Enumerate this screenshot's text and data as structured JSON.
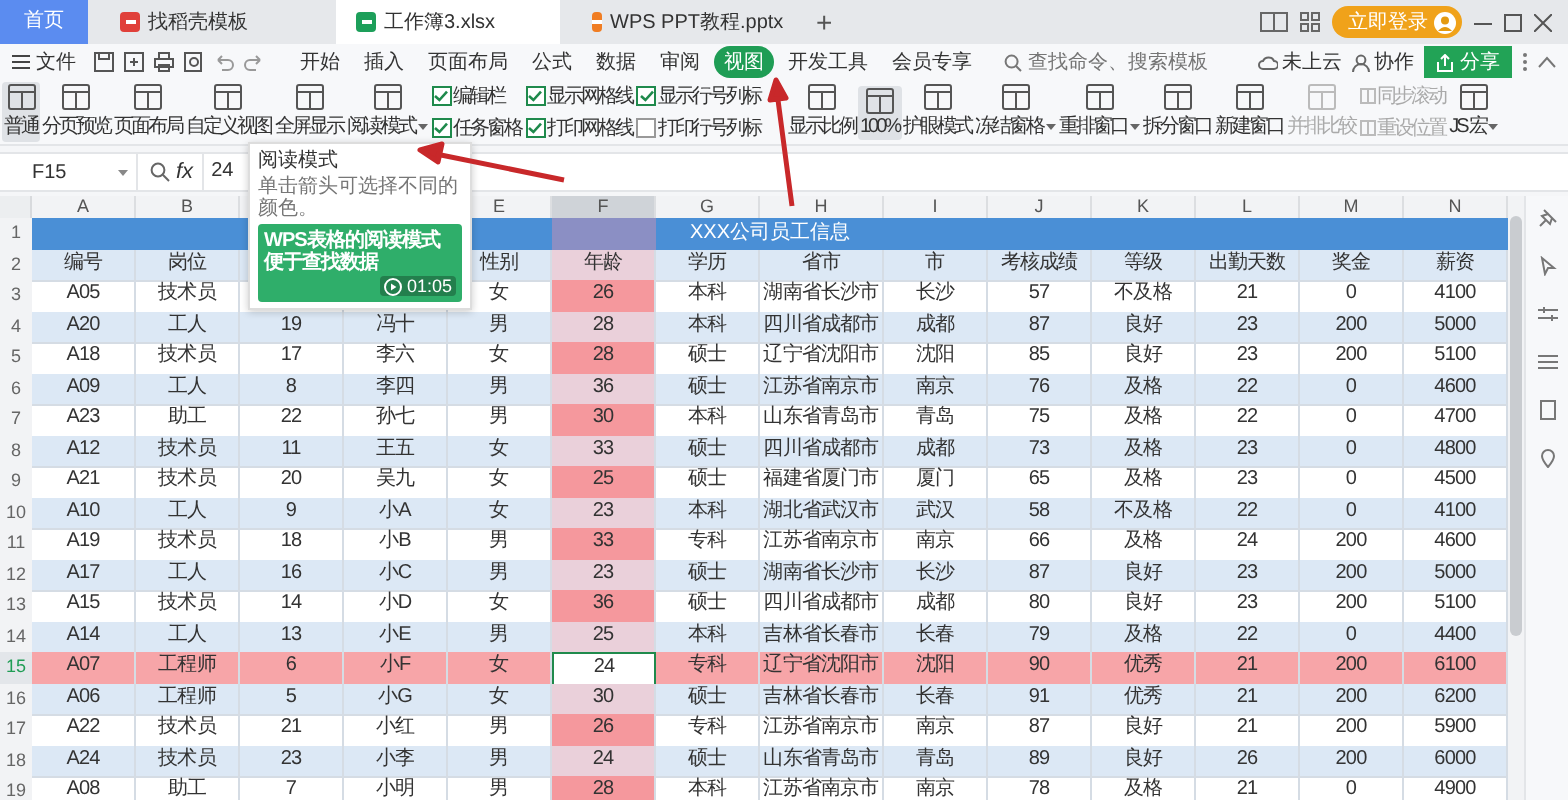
{
  "window_tabs": [
    {
      "label": "首页",
      "kind": "home",
      "selected": false
    },
    {
      "label": "找稻壳模板",
      "kind": "docer",
      "selected": false
    },
    {
      "label": "工作簿3.xlsx",
      "kind": "sheet",
      "selected": true
    },
    {
      "label": "WPS PPT教程.pptx",
      "kind": "ppt",
      "selected": false
    }
  ],
  "new_tab": "+",
  "login_button": "立即登录",
  "menu": {
    "file": "文件",
    "tabs": [
      {
        "label": "开始",
        "selected": false
      },
      {
        "label": "插入",
        "selected": false
      },
      {
        "label": "页面布局",
        "selected": false
      },
      {
        "label": "公式",
        "selected": false
      },
      {
        "label": "数据",
        "selected": false
      },
      {
        "label": "审阅",
        "selected": false
      },
      {
        "label": "视图",
        "selected": true
      },
      {
        "label": "开发工具",
        "selected": false
      },
      {
        "label": "会员专享",
        "selected": false
      }
    ],
    "search": {
      "placeholder": "查找命令、搜索模板"
    },
    "cloud": "未上云",
    "collab": "协作",
    "share": "分享"
  },
  "ribbon": [
    {
      "kind": "button",
      "label": "普通",
      "selected": true,
      "disabled": false,
      "dropdown": false
    },
    {
      "kind": "button",
      "label": "分页预览",
      "selected": false,
      "disabled": false,
      "dropdown": false
    },
    {
      "kind": "button",
      "label": "页面布局",
      "selected": false,
      "disabled": false,
      "dropdown": false
    },
    {
      "kind": "button",
      "label": "自定义视图",
      "selected": false,
      "disabled": false,
      "dropdown": false
    },
    {
      "kind": "button",
      "label": "全屏显示",
      "selected": false,
      "disabled": false,
      "dropdown": false
    },
    {
      "kind": "button",
      "label": "阅读模式",
      "selected": false,
      "disabled": false,
      "dropdown": true
    },
    {
      "kind": "checks",
      "checks": [
        {
          "label": "编辑栏",
          "checked": true
        },
        {
          "label": "任务窗格",
          "checked": true
        }
      ]
    },
    {
      "kind": "checks",
      "checks": [
        {
          "label": "显示网格线",
          "checked": true
        },
        {
          "label": "打印网格线",
          "checked": true
        }
      ]
    },
    {
      "kind": "checks",
      "checks": [
        {
          "label": "显示行号列标",
          "checked": true
        },
        {
          "label": "打印行号列标",
          "checked": false
        }
      ]
    },
    {
      "kind": "button",
      "label": "显示比例",
      "selected": false,
      "disabled": false,
      "dropdown": false
    },
    {
      "kind": "button",
      "label": "100%",
      "selected": true,
      "disabled": false,
      "dropdown": false
    },
    {
      "kind": "button",
      "label": "护眼模式",
      "selected": false,
      "disabled": false,
      "dropdown": false
    },
    {
      "kind": "button",
      "label": "冻结窗格",
      "selected": false,
      "disabled": false,
      "dropdown": true
    },
    {
      "kind": "button",
      "label": "重排窗口",
      "selected": false,
      "disabled": false,
      "dropdown": true
    },
    {
      "kind": "button",
      "label": "拆分窗口",
      "selected": false,
      "disabled": false,
      "dropdown": false
    },
    {
      "kind": "button",
      "label": "新建窗口",
      "selected": false,
      "disabled": false,
      "dropdown": false
    },
    {
      "kind": "button",
      "label": "并排比较",
      "selected": false,
      "disabled": true,
      "dropdown": false
    },
    {
      "kind": "smalls",
      "items": [
        {
          "label": "同步滚动",
          "disabled": true
        },
        {
          "label": "重设位置",
          "disabled": true
        }
      ]
    },
    {
      "kind": "button",
      "label": "JS 宏",
      "selected": false,
      "disabled": false,
      "dropdown": true
    }
  ],
  "formula_bar": {
    "cell": "F15",
    "fx": "fx",
    "value": "24"
  },
  "tooltip": {
    "title": "阅读模式",
    "text": "单击箭头可选择不同的颜色。",
    "video_title": "WPS表格的阅读模式便于查找数据",
    "duration": "01:05"
  },
  "sheet": {
    "columns": [
      {
        "label": "A",
        "selected": false
      },
      {
        "label": "B",
        "selected": false
      },
      null,
      null,
      {
        "label": "E",
        "selected": false
      },
      {
        "label": "F",
        "selected": true
      },
      {
        "label": "G",
        "selected": false
      },
      {
        "label": "H",
        "selected": false
      },
      {
        "label": "I",
        "selected": false
      },
      {
        "label": "J",
        "selected": false
      },
      {
        "label": "K",
        "selected": false
      },
      {
        "label": "L",
        "selected": false
      },
      {
        "label": "M",
        "selected": false
      },
      {
        "label": "N",
        "selected": false
      }
    ],
    "title_row": {
      "number": "1",
      "title": "XXX公司员工信息"
    },
    "rows": [
      {
        "number": "2",
        "selected": false,
        "cells": [
          "编号",
          "岗位",
          null,
          null,
          "性别",
          "年龄",
          "学历",
          "省市",
          "市",
          "考核成绩",
          "等级",
          "出勤天数",
          "奖金",
          "薪资"
        ]
      },
      {
        "number": "3",
        "selected": false,
        "cells": [
          "A05",
          "技术员",
          null,
          null,
          "女",
          "26",
          "本科",
          "湖南省长沙市",
          "长沙",
          "57",
          "不及格",
          "21",
          "0",
          "4100"
        ]
      },
      {
        "number": "4",
        "selected": false,
        "cells": [
          "A20",
          "工人",
          "19",
          "冯十",
          "男",
          "28",
          "本科",
          "四川省成都市",
          "成都",
          "87",
          "良好",
          "23",
          "200",
          "5000"
        ]
      },
      {
        "number": "5",
        "selected": false,
        "cells": [
          "A18",
          "技术员",
          "17",
          "李六",
          "女",
          "28",
          "硕士",
          "辽宁省沈阳市",
          "沈阳",
          "85",
          "良好",
          "23",
          "200",
          "5100"
        ]
      },
      {
        "number": "6",
        "selected": false,
        "cells": [
          "A09",
          "工人",
          "8",
          "李四",
          "男",
          "36",
          "硕士",
          "江苏省南京市",
          "南京",
          "76",
          "及格",
          "22",
          "0",
          "4600"
        ]
      },
      {
        "number": "7",
        "selected": false,
        "cells": [
          "A23",
          "助工",
          "22",
          "孙七",
          "男",
          "30",
          "本科",
          "山东省青岛市",
          "青岛",
          "75",
          "及格",
          "22",
          "0",
          "4700"
        ]
      },
      {
        "number": "8",
        "selected": false,
        "cells": [
          "A12",
          "技术员",
          "11",
          "王五",
          "女",
          "33",
          "硕士",
          "四川省成都市",
          "成都",
          "73",
          "及格",
          "23",
          "0",
          "4800"
        ]
      },
      {
        "number": "9",
        "selected": false,
        "cells": [
          "A21",
          "技术员",
          "20",
          "吴九",
          "女",
          "25",
          "硕士",
          "福建省厦门市",
          "厦门",
          "65",
          "及格",
          "23",
          "0",
          "4500"
        ]
      },
      {
        "number": "10",
        "selected": false,
        "cells": [
          "A10",
          "工人",
          "9",
          "小A",
          "女",
          "23",
          "本科",
          "湖北省武汉市",
          "武汉",
          "58",
          "不及格",
          "22",
          "0",
          "4100"
        ]
      },
      {
        "number": "11",
        "selected": false,
        "cells": [
          "A19",
          "技术员",
          "18",
          "小B",
          "男",
          "33",
          "专科",
          "江苏省南京市",
          "南京",
          "66",
          "及格",
          "24",
          "200",
          "4600"
        ]
      },
      {
        "number": "12",
        "selected": false,
        "cells": [
          "A17",
          "工人",
          "16",
          "小C",
          "男",
          "23",
          "硕士",
          "湖南省长沙市",
          "长沙",
          "87",
          "良好",
          "23",
          "200",
          "5000"
        ]
      },
      {
        "number": "13",
        "selected": false,
        "cells": [
          "A15",
          "技术员",
          "14",
          "小D",
          "女",
          "36",
          "硕士",
          "四川省成都市",
          "成都",
          "80",
          "良好",
          "23",
          "200",
          "5100"
        ]
      },
      {
        "number": "14",
        "selected": false,
        "cells": [
          "A14",
          "工人",
          "13",
          "小E",
          "男",
          "25",
          "本科",
          "吉林省长春市",
          "长春",
          "79",
          "及格",
          "22",
          "0",
          "4400"
        ]
      },
      {
        "number": "15",
        "selected": true,
        "cells": [
          "A07",
          "工程师",
          "6",
          "小F",
          "女",
          "24",
          "专科",
          "辽宁省沈阳市",
          "沈阳",
          "90",
          "优秀",
          "21",
          "200",
          "6100"
        ]
      },
      {
        "number": "16",
        "selected": false,
        "cells": [
          "A06",
          "工程师",
          "5",
          "小G",
          "女",
          "30",
          "硕士",
          "吉林省长春市",
          "长春",
          "91",
          "优秀",
          "21",
          "200",
          "6200"
        ]
      },
      {
        "number": "17",
        "selected": false,
        "cells": [
          "A22",
          "技术员",
          "21",
          "小红",
          "男",
          "26",
          "专科",
          "江苏省南京市",
          "南京",
          "87",
          "良好",
          "21",
          "200",
          "5900"
        ]
      },
      {
        "number": "18",
        "selected": false,
        "cells": [
          "A24",
          "技术员",
          "23",
          "小李",
          "男",
          "24",
          "硕士",
          "山东省青岛市",
          "青岛",
          "89",
          "良好",
          "26",
          "200",
          "6000"
        ]
      },
      {
        "number": "19",
        "selected": false,
        "cells": [
          "A08",
          "助工",
          "7",
          "小明",
          "男",
          "28",
          "本科",
          "江苏省南京市",
          "南京",
          "78",
          "及格",
          "21",
          "0",
          "4900"
        ]
      }
    ]
  }
}
